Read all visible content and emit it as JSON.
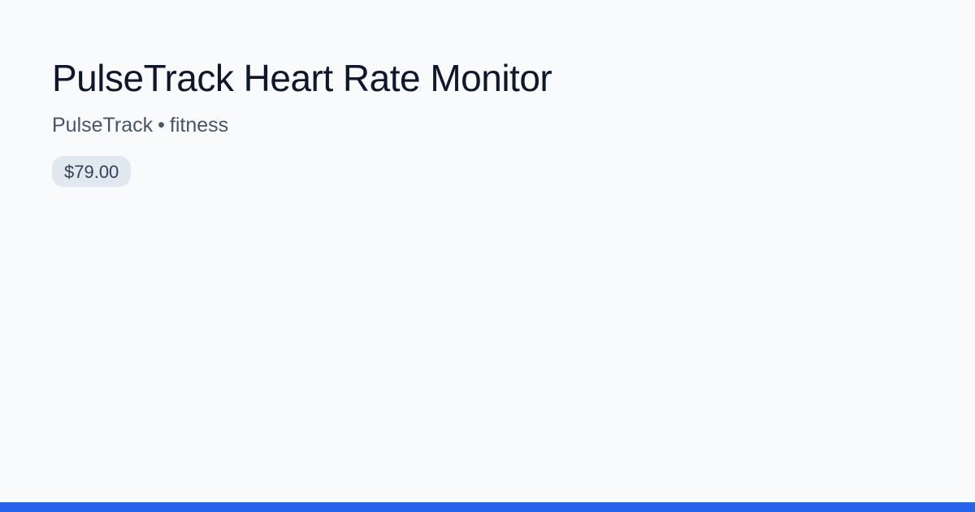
{
  "product": {
    "title": "PulseTrack Heart Rate Monitor",
    "brand": "PulseTrack",
    "separator": "•",
    "category": "fitness",
    "price": "$79.00"
  },
  "colors": {
    "background": "#f8fafc",
    "title": "#0f172a",
    "subtitle": "#475569",
    "badge_bg": "#e2e8f0",
    "accent_bar": "#2563eb"
  }
}
